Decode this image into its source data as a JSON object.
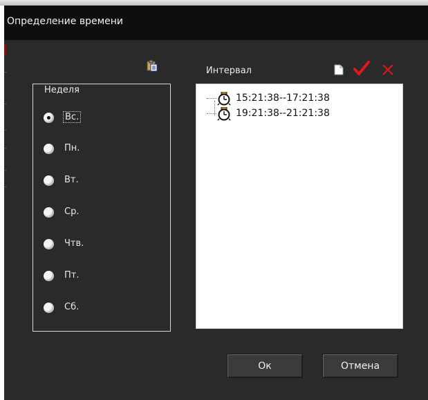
{
  "dialog": {
    "title": "Определение времени"
  },
  "week": {
    "legend": "Неделя",
    "selected_index": 0,
    "days": [
      {
        "label": "Вс."
      },
      {
        "label": "Пн."
      },
      {
        "label": "Вт."
      },
      {
        "label": "Ср."
      },
      {
        "label": "Чтв."
      },
      {
        "label": "Пт."
      },
      {
        "label": "Сб."
      }
    ]
  },
  "interval": {
    "label": "Интервал",
    "items": [
      {
        "text": "15:21:38--17:21:38",
        "icon": "clock-icon"
      },
      {
        "text": "19:21:38--21:21:38",
        "icon": "clock-icon"
      }
    ],
    "toolbar_icons": [
      "new-document-icon",
      "confirm-check-icon",
      "delete-cross-icon"
    ]
  },
  "buttons": {
    "ok_label": "Ок",
    "cancel_label": "Отмена"
  },
  "colors": {
    "dialog_bg": "#2a2a2a",
    "titlebar_bg": "#0e0e0e",
    "accent_red": "#e01818"
  }
}
